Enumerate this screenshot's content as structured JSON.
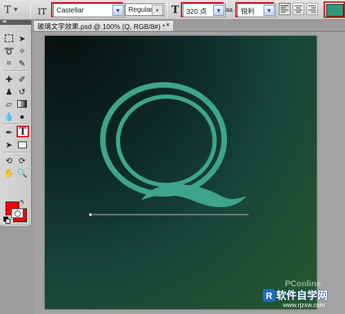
{
  "options_bar": {
    "tool_preset_glyph": "T",
    "orientation_glyph": "IT",
    "font_family": "Castellar",
    "font_style": "Regular",
    "size_glyph": "T",
    "font_size": "320 点",
    "aa_glyph": "aa",
    "anti_alias": "锐利",
    "text_color": "#2e9a7a",
    "align": [
      "left-align",
      "center-align",
      "right-align"
    ]
  },
  "tools": {
    "active_tool_glyph": "T",
    "foreground_color": "#ff0000",
    "background_color": "#ff0000"
  },
  "document": {
    "tab_title": "玻璃文字效果.psd @ 100% (Q, RGB/8#) *",
    "close_glyph": "×",
    "canvas_letter": "Q",
    "letter_color": "#3ea58a"
  },
  "watermarks": {
    "pconline": "PConline",
    "site_badge": "R",
    "site_title": "软件自学网",
    "site_url": "www.rjzxw.com"
  }
}
